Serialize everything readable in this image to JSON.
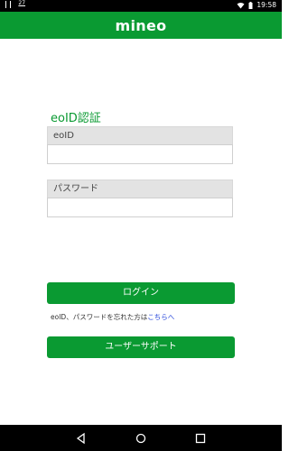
{
  "status": {
    "notification_count": "27",
    "time": "19:58"
  },
  "header": {
    "brand": "mineo"
  },
  "form": {
    "title": "eoID認証",
    "eoid_label": "eoID",
    "eoid_value": "",
    "password_label": "パスワード",
    "password_value": ""
  },
  "actions": {
    "login_label": "ログイン",
    "forgot_prefix": "eoID、パスワードを忘れた方は",
    "forgot_link": "こちらへ",
    "support_label": "ユーザーサポート"
  },
  "icons": {
    "back": "back-icon",
    "home": "home-icon",
    "recents": "recents-icon"
  },
  "colors": {
    "brand_green": "#0a9a32",
    "link_blue": "#1a3bd8"
  }
}
